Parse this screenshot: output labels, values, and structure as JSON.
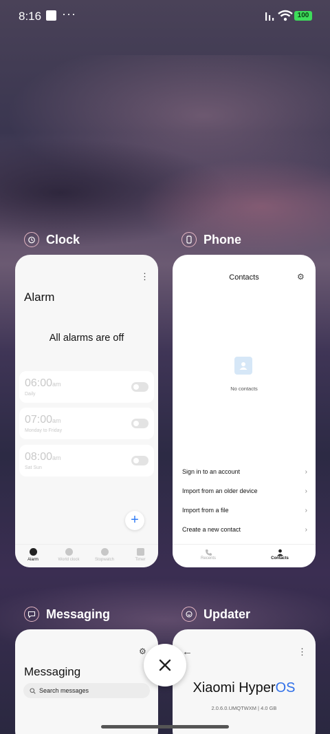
{
  "status": {
    "time": "8:16",
    "more": "···",
    "battery": "100"
  },
  "apps": {
    "clock": {
      "name": "Clock",
      "screen_title": "Alarm",
      "empty_message": "All alarms are off",
      "alarms": [
        {
          "time": "06:00",
          "suffix": "am",
          "days": "Daily",
          "enabled": false
        },
        {
          "time": "07:00",
          "suffix": "am",
          "days": "Monday to Friday",
          "enabled": false
        },
        {
          "time": "08:00",
          "suffix": "am",
          "days": "Sat Sun",
          "enabled": false
        }
      ],
      "tabs": [
        "Alarm",
        "World clock",
        "Stopwatch",
        "Timer"
      ],
      "active_tab": "Alarm"
    },
    "phone": {
      "name": "Phone",
      "screen_title": "Contacts",
      "empty_message": "No contacts",
      "actions": [
        "Sign in to an account",
        "Import from an older device",
        "Import from a file",
        "Create a new contact"
      ],
      "tabs": [
        "Recents",
        "Contacts"
      ],
      "active_tab": "Contacts"
    },
    "messaging": {
      "name": "Messaging",
      "screen_title": "Messaging",
      "search_placeholder": "Search messages"
    },
    "updater": {
      "name": "Updater",
      "brand_text": "Xiaomi Hyper",
      "brand_accent": "OS",
      "version": "2.0.6.0.UMQTWXM | 4.0 GB"
    }
  },
  "colors": {
    "accent": "#2f7bf5",
    "battery": "#3ddc5a",
    "icon_ring": "#e6b8c4"
  }
}
